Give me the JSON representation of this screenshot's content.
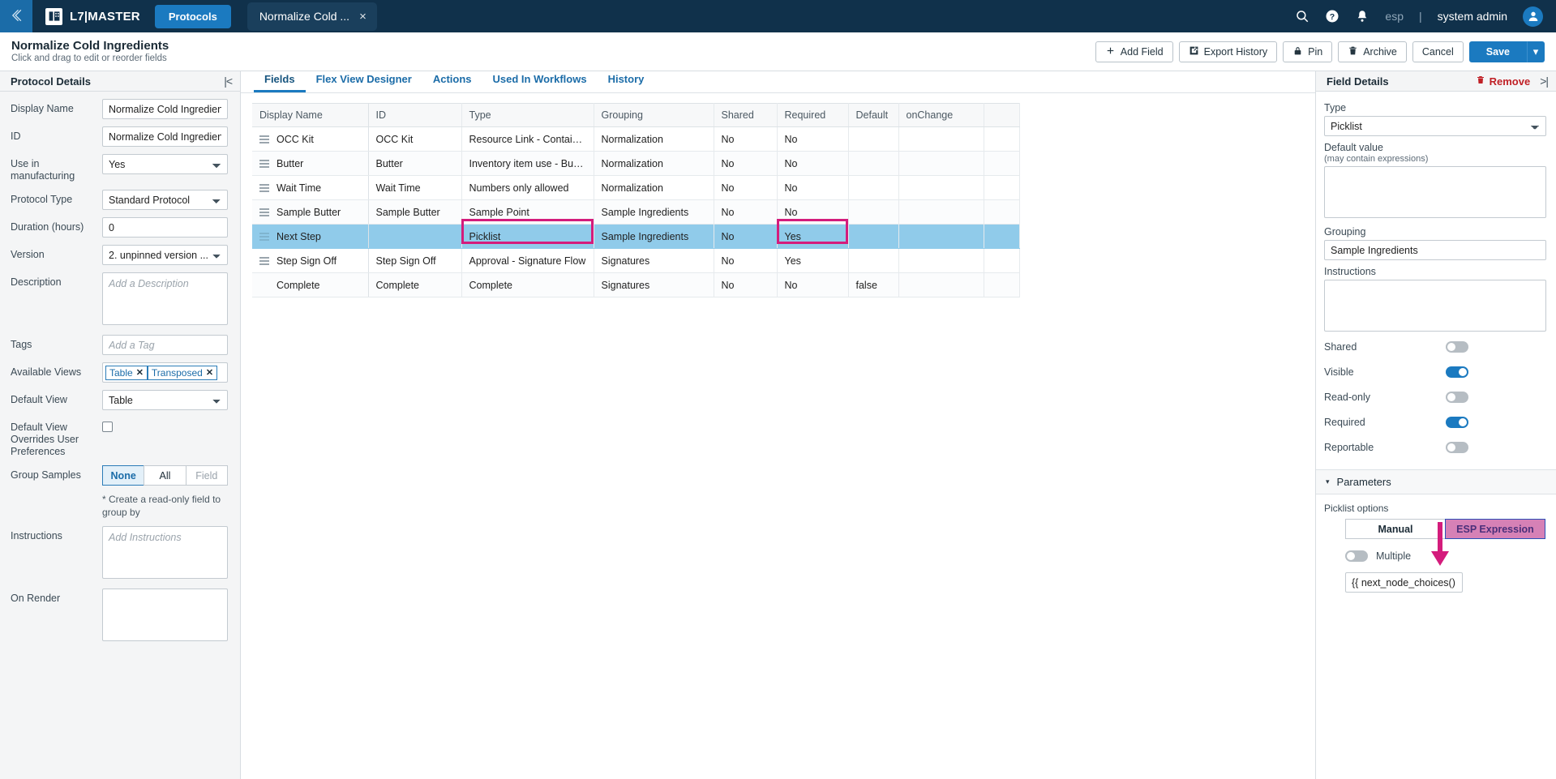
{
  "topbar": {
    "back_icon": "chevrons-left-icon",
    "brand": "L7|MASTER",
    "nav_pill": "Protocols",
    "tab_chip": "Normalize Cold ...",
    "tab_close": "×",
    "search_icon": "search-icon",
    "help_icon": "help-circle-icon",
    "bell_icon": "bell-icon",
    "esp": "esp",
    "pipe": "|",
    "user": "system admin",
    "avatar_icon": "user-avatar-icon"
  },
  "pagehead": {
    "title": "Normalize Cold Ingredients",
    "subtitle": "Click and drag to edit or reorder fields",
    "add_field": "Add Field",
    "export_history": "Export History",
    "pin": "Pin",
    "archive": "Archive",
    "cancel": "Cancel",
    "save": "Save",
    "save_caret": "▾"
  },
  "sidebar": {
    "title": "Protocol Details",
    "collapse_icon": "collapse-left-icon",
    "display_name_label": "Display Name",
    "display_name_value": "Normalize Cold Ingredient",
    "id_label": "ID",
    "id_value": "Normalize Cold Ingredient",
    "use_mfg_label": "Use in manufacturing",
    "use_mfg_value": "Yes",
    "protocol_type_label": "Protocol Type",
    "protocol_type_value": "Standard Protocol",
    "duration_label": "Duration (hours)",
    "duration_value": "0",
    "version_label": "Version",
    "version_value": "2. unpinned version ...",
    "description_label": "Description",
    "description_placeholder": "Add a Description",
    "tags_label": "Tags",
    "tags_placeholder": "Add a Tag",
    "available_views_label": "Available Views",
    "available_views": [
      "Table",
      "Transposed"
    ],
    "chip_close": "✕",
    "default_view_label": "Default View",
    "default_view_value": "Table",
    "overrides_label": "Default View Overrides User Preferences",
    "group_samples_label": "Group Samples",
    "group_samples_options": [
      "None",
      "All",
      "Field"
    ],
    "group_samples_selected": "None",
    "group_hint": "* Create a read-only field to group by",
    "instructions_label": "Instructions",
    "instructions_placeholder": "Add Instructions",
    "on_render_label": "On Render",
    "on_render_value": ""
  },
  "main": {
    "tabs": [
      {
        "label": "Fields",
        "active": true
      },
      {
        "label": "Flex View Designer",
        "active": false
      },
      {
        "label": "Actions",
        "active": false
      },
      {
        "label": "Used In Workflows",
        "active": false
      },
      {
        "label": "History",
        "active": false
      }
    ],
    "columns": [
      "Display Name",
      "ID",
      "Type",
      "Grouping",
      "Shared",
      "Required",
      "Default",
      "onChange"
    ],
    "rows": [
      {
        "name": "OCC Kit",
        "id": "OCC Kit",
        "type": "Resource Link - Container",
        "grouping": "Normalization",
        "shared": "No",
        "required": "No",
        "default": "",
        "onchange": "",
        "selected": false
      },
      {
        "name": "Butter",
        "id": "Butter",
        "type": "Inventory item use - Butter",
        "grouping": "Normalization",
        "shared": "No",
        "required": "No",
        "default": "",
        "onchange": "",
        "selected": false
      },
      {
        "name": "Wait Time",
        "id": "Wait Time",
        "type": "Numbers only allowed",
        "grouping": "Normalization",
        "shared": "No",
        "required": "No",
        "default": "",
        "onchange": "",
        "selected": false
      },
      {
        "name": "Sample Butter",
        "id": "Sample Butter",
        "type": "Sample Point",
        "grouping": "Sample Ingredients",
        "shared": "No",
        "required": "No",
        "default": "",
        "onchange": "",
        "selected": false
      },
      {
        "name": "Next Step",
        "id": "",
        "type": "Picklist",
        "grouping": "Sample Ingredients",
        "shared": "No",
        "required": "Yes",
        "default": "",
        "onchange": "",
        "selected": true
      },
      {
        "name": "Step Sign Off",
        "id": "Step Sign Off",
        "type": "Approval - Signature Flow",
        "grouping": "Signatures",
        "shared": "No",
        "required": "Yes",
        "default": "",
        "onchange": "",
        "selected": false
      },
      {
        "name": "Complete",
        "id": "Complete",
        "type": "Complete",
        "grouping": "Signatures",
        "shared": "No",
        "required": "No",
        "default": "false",
        "onchange": "",
        "selected": false
      }
    ],
    "grip_icon": "drag-handle-icon"
  },
  "field_details": {
    "title": "Field Details",
    "remove_label": "Remove",
    "remove_icon": "trash-icon",
    "collapse_icon": "collapse-right-icon",
    "type_label": "Type",
    "type_value": "Picklist",
    "default_value_label": "Default value",
    "default_value_sub": "(may contain expressions)",
    "default_value": "",
    "grouping_label": "Grouping",
    "grouping_value": "Sample Ingredients",
    "instructions_label": "Instructions",
    "instructions_value": "",
    "toggles": [
      {
        "label": "Shared",
        "on": false
      },
      {
        "label": "Visible",
        "on": true
      },
      {
        "label": "Read-only",
        "on": false
      },
      {
        "label": "Required",
        "on": true
      },
      {
        "label": "Reportable",
        "on": false
      }
    ],
    "parameters_title": "Parameters",
    "parameters_caret": "▾",
    "picklist_options_label": "Picklist options",
    "mode_options": [
      "Manual",
      "ESP Expression"
    ],
    "mode_selected": "ESP Expression",
    "multiple_label": "Multiple",
    "multiple_on": false,
    "expression_value": "{{ next_node_choices() }}"
  },
  "colors": {
    "topbar_bg": "#10314b",
    "accent_blue": "#1b7ac0",
    "selected_row": "#90cbea",
    "annotation_pink": "#d41c7c",
    "esp_pink": "#d681b6"
  }
}
